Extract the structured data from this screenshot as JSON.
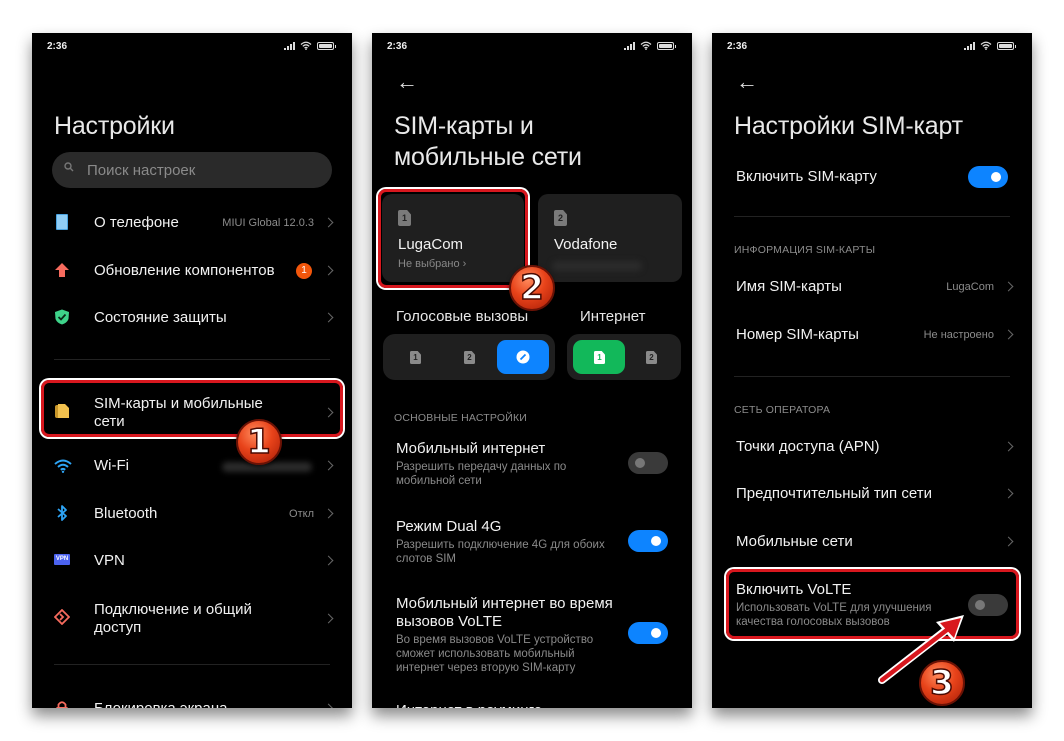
{
  "status_bar": {
    "time": "2:36"
  },
  "screen1": {
    "title": "Настройки",
    "search_placeholder": "Поиск настроек",
    "items": [
      {
        "label": "О телефоне",
        "value": "MIUI Global 12.0.3",
        "icon": "phone-icon"
      },
      {
        "label": "Обновление компонентов",
        "badge": "1",
        "icon": "update-arrow-icon"
      },
      {
        "label": "Состояние защиты",
        "icon": "shield-icon"
      },
      {
        "label": "SIM-карты и мобильные сети",
        "icon": "sim-cards-icon"
      },
      {
        "label": "Wi-Fi",
        "value": "",
        "icon": "wifi-icon"
      },
      {
        "label": "Bluetooth",
        "value": "Откл",
        "icon": "bluetooth-icon"
      },
      {
        "label": "VPN",
        "icon": "vpn-icon",
        "icon_text": "VPN"
      },
      {
        "label": "Подключение и общий доступ",
        "icon": "connection-sharing-icon"
      },
      {
        "label": "Блокировка экрана",
        "icon": "lock-icon"
      }
    ],
    "step": "1"
  },
  "screen2": {
    "title_line1": "SIM-карты и",
    "title_line2": "мобильные сети",
    "sims": [
      {
        "slot": "1",
        "name": "LugaCom",
        "status": "Не выбрано"
      },
      {
        "slot": "2",
        "name": "Vodafone",
        "status": ""
      }
    ],
    "voice_calls_label": "Голосовые вызовы",
    "internet_label": "Интернет",
    "voice_options": [
      "1",
      "2",
      "ask"
    ],
    "voice_selected": "ask",
    "internet_options": [
      "1",
      "2"
    ],
    "internet_selected": "1",
    "section_basic": "ОСНОВНЫЕ НАСТРОЙКИ",
    "settings": [
      {
        "title": "Мобильный интернет",
        "desc_line1": "Разрешить передачу данных по",
        "desc_line2": "мобильной сети",
        "enabled": false
      },
      {
        "title": "Режим Dual 4G",
        "desc_line1": "Разрешить подключение 4G для обоих",
        "desc_line2": "слотов SIM",
        "enabled": true
      },
      {
        "title_line1": "Мобильный интернет во время",
        "title_line2": "вызовов VoLTE",
        "desc_line1": "Во время вызовов VoLTE устройство",
        "desc_line2": "сможет использовать мобильный",
        "desc_line3": "интернет через вторую SIM-карту",
        "enabled": true
      },
      {
        "title": "Интернет в роуминге"
      }
    ],
    "step": "2"
  },
  "screen3": {
    "title": "Настройки SIM-карт",
    "enable_sim_label": "Включить SIM-карту",
    "enable_sim_on": true,
    "section_info": "ИНФОРМАЦИЯ SIM-КАРТЫ",
    "sim_name_label": "Имя SIM-карты",
    "sim_name_value": "LugaCom",
    "sim_number_label": "Номер SIM-карты",
    "sim_number_value": "Не настроено",
    "section_operator": "СЕТЬ ОПЕРАТОРА",
    "apn_label": "Точки доступа (APN)",
    "pref_network_label": "Предпочтительный тип сети",
    "mobile_networks_label": "Мобильные сети",
    "volte_title": "Включить VoLTE",
    "volte_desc_line1": "Использовать VoLTE для улучшения",
    "volte_desc_line2": "качества голосовых вызовов",
    "volte_on": false,
    "step": "3"
  },
  "colors": {
    "accent_blue": "#0d84ff",
    "accent_green": "#12b85a",
    "highlight_red": "#d8171e",
    "badge_orange": "#f2560b"
  }
}
